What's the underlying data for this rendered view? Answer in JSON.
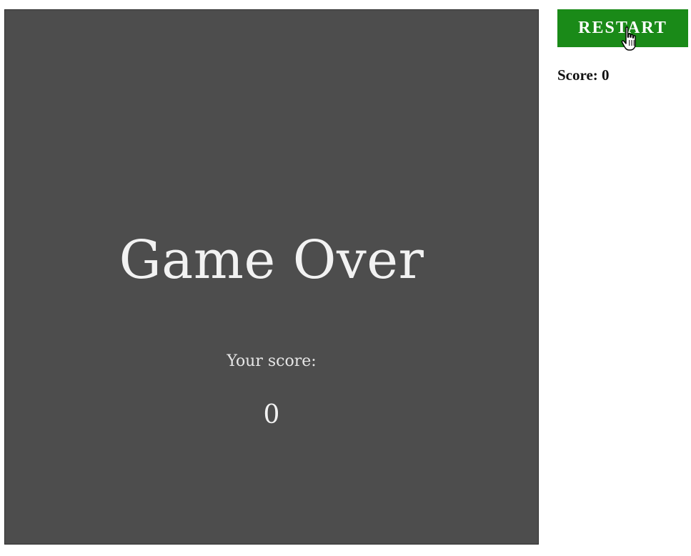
{
  "board": {
    "title": "Game Over",
    "score_label": "Your score:",
    "score_value": "0",
    "background": "#4d4d4d",
    "text_color": "#f2f2f2"
  },
  "sidebar": {
    "restart_label": "RESTART",
    "restart_color": "#1a8a18",
    "score_text": "Score: 0"
  },
  "cursor": {
    "icon": "hand-pointer-icon"
  }
}
